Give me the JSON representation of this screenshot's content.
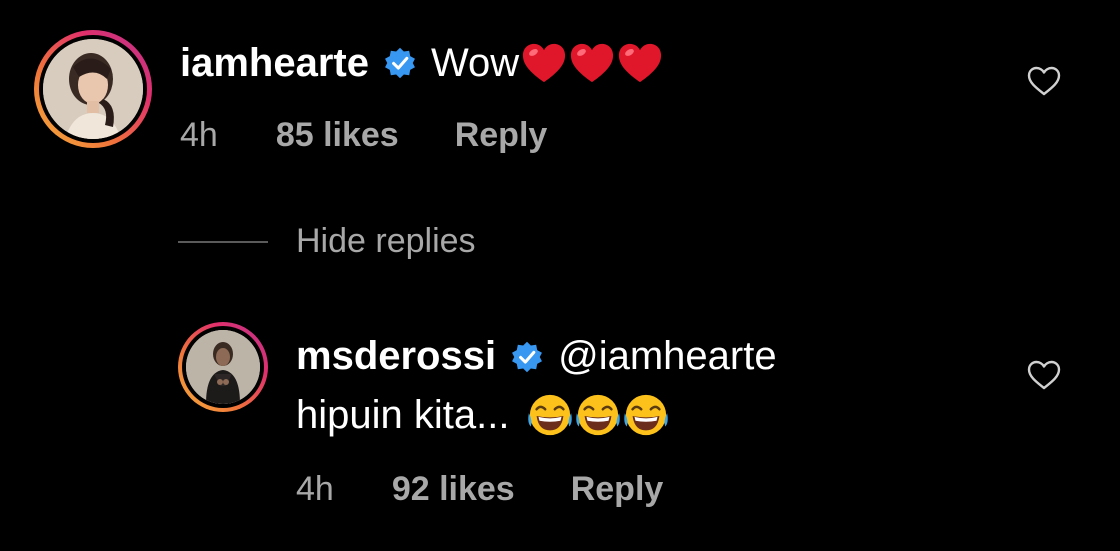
{
  "comments": [
    {
      "username": "iamhearte",
      "verified": true,
      "text": "Wow",
      "emoji": [
        "red-heart",
        "red-heart",
        "red-heart"
      ],
      "time": "4h",
      "likes": "85 likes",
      "reply": "Reply"
    }
  ],
  "replies_toggle": {
    "label": "Hide replies"
  },
  "replies": [
    {
      "username": "msderossi",
      "verified": true,
      "mention": "@iamhearte",
      "text": "hipuin kita...",
      "emoji": [
        "face-with-tears-of-joy",
        "face-with-tears-of-joy",
        "face-with-tears-of-joy"
      ],
      "time": "4h",
      "likes": "92 likes",
      "reply": "Reply"
    }
  ],
  "colors": {
    "background": "#000000",
    "primary_text": "#ffffff",
    "secondary_text": "#a8a8a8",
    "verified_badge": "#3897f0",
    "heart_emoji": "#e0162b"
  },
  "icons": {
    "verified": "verified-badge-icon",
    "like": "heart-outline-icon"
  }
}
